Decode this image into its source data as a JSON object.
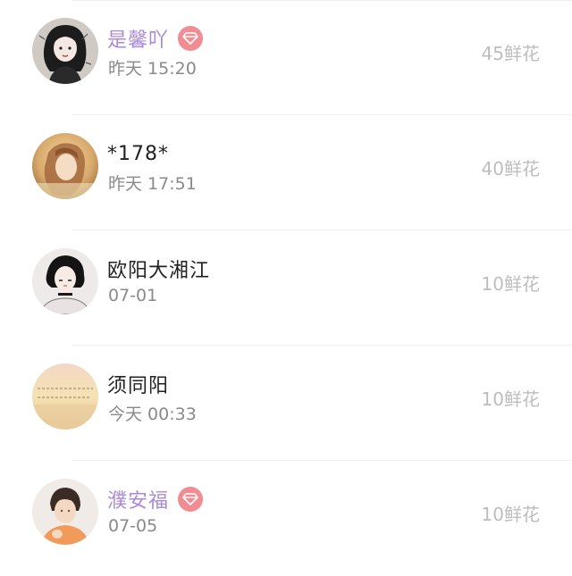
{
  "list": {
    "items": [
      {
        "name": "是馨吖",
        "vip": true,
        "time": "昨天 15:20",
        "flowers": "45鲜花",
        "avatar_icon": "avatar-girl-dark-hair"
      },
      {
        "name": "*178*",
        "vip": false,
        "time": "昨天 17:51",
        "flowers": "40鲜花",
        "avatar_icon": "avatar-girl-warm-photo"
      },
      {
        "name": "欧阳大湘江",
        "vip": false,
        "time": "07-01",
        "flowers": "10鲜花",
        "avatar_icon": "avatar-anime-character"
      },
      {
        "name": "须同阳",
        "vip": false,
        "time": "今天 00:33",
        "flowers": "10鲜花",
        "avatar_icon": "avatar-text-quote-image"
      },
      {
        "name": "濮安福",
        "vip": true,
        "time": "07-05",
        "flowers": "10鲜花",
        "avatar_icon": "avatar-boy-orange-shirt"
      }
    ]
  },
  "colors": {
    "vip_name": "#a98ad6",
    "vip_badge": "#f28c93",
    "flowers_text": "#bdbdbd",
    "time_text": "#8a8a8a"
  }
}
